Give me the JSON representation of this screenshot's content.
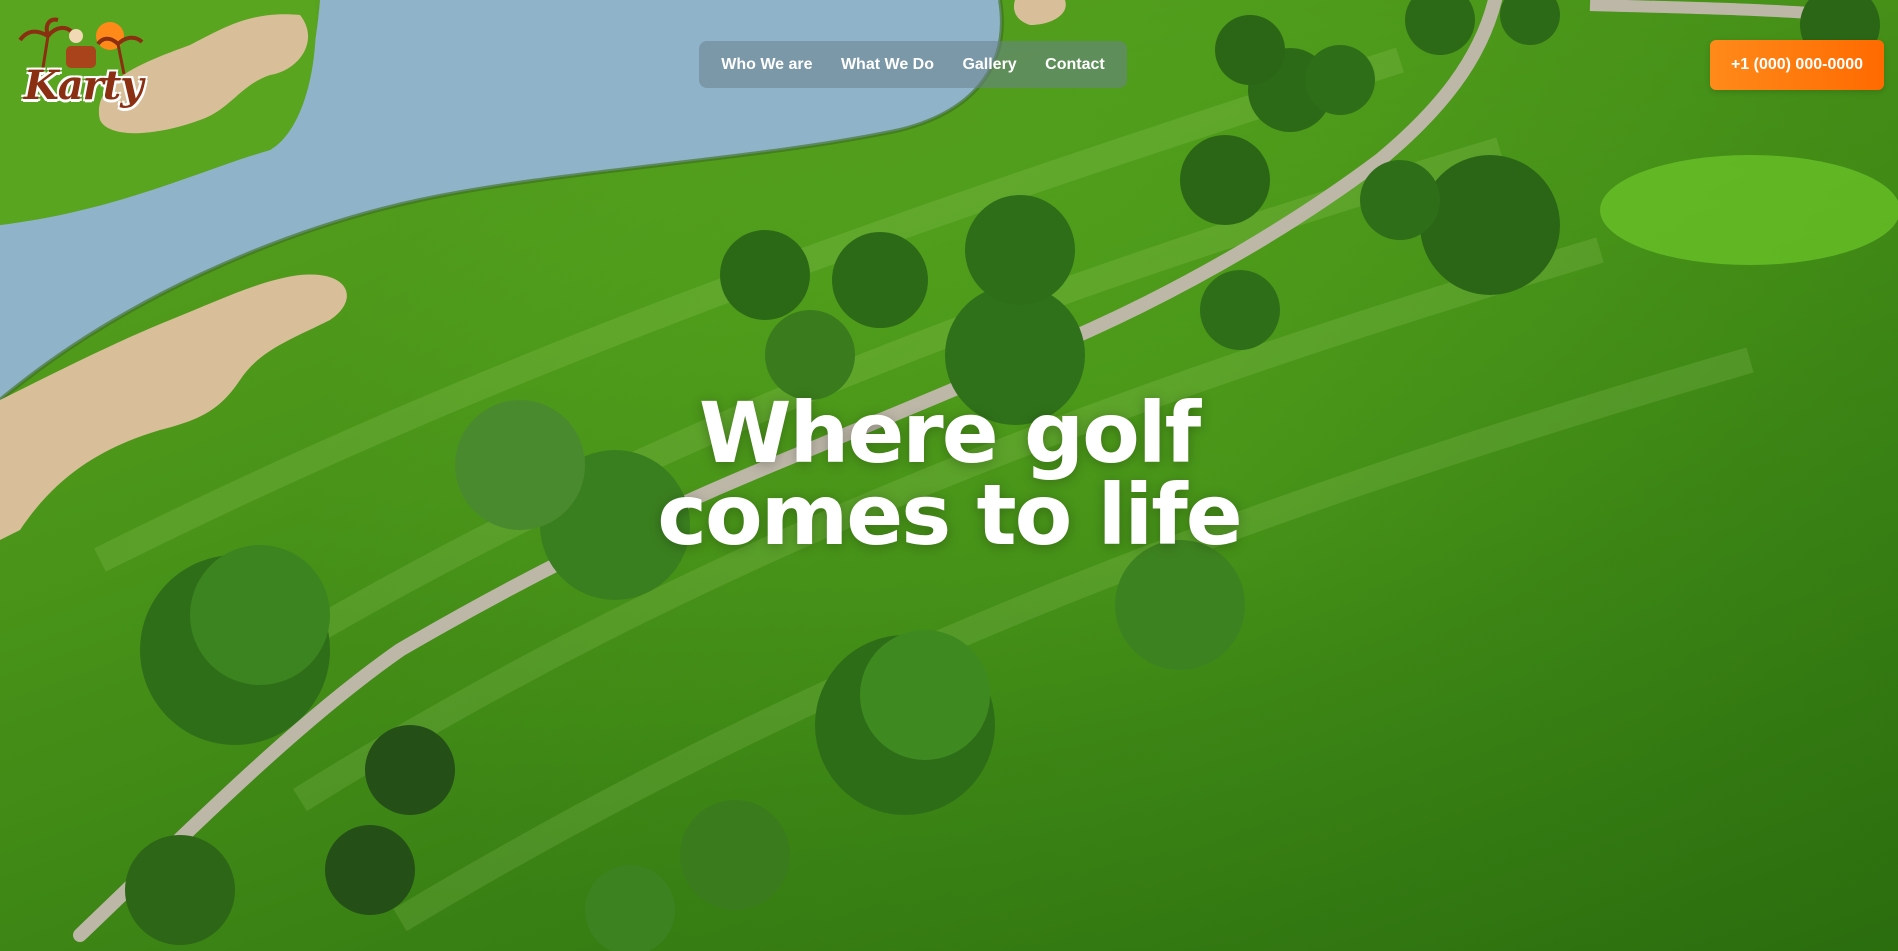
{
  "brand": {
    "name": "Karty"
  },
  "nav": {
    "items": [
      {
        "label": "Who We are"
      },
      {
        "label": "What We Do"
      },
      {
        "label": "Gallery"
      },
      {
        "label": "Contact"
      }
    ]
  },
  "cta": {
    "phone": "+1 (000) 000-0000"
  },
  "hero": {
    "line1": "Where golf",
    "line2": "comes to life",
    "background": "aerial golf course with lake, sand bunkers, cart path and trees"
  },
  "colors": {
    "accent": "#ff7a0d",
    "grass": "#58a81e",
    "water": "#8fb3c9",
    "sand": "#d8bf9a",
    "logo": "#8b2f12"
  }
}
